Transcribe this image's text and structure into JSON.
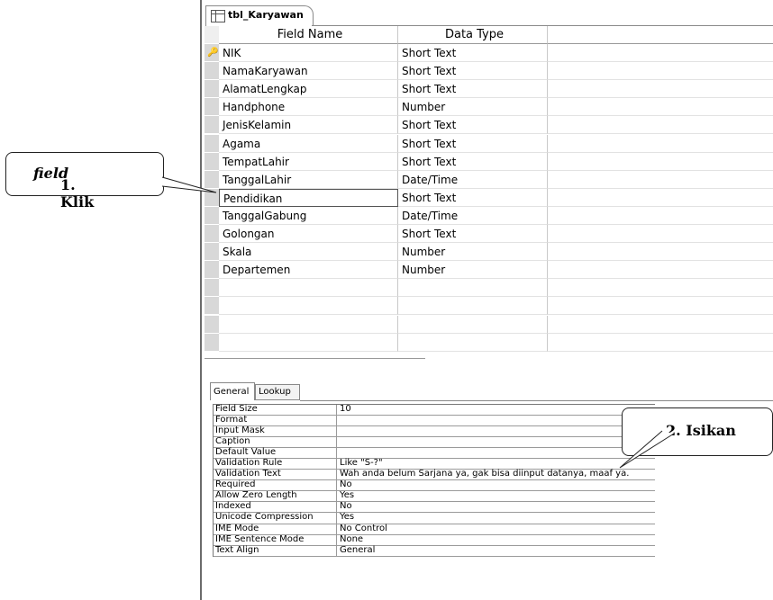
{
  "window": {
    "tab_title": "tbl_Karyawan",
    "tab_icon": "table-icon"
  },
  "grid": {
    "headers": {
      "field_name": "Field Name",
      "data_type": "Data Type"
    },
    "rows": [
      {
        "field": "NIK",
        "type": "Short Text",
        "key": true
      },
      {
        "field": "NamaKaryawan",
        "type": "Short Text"
      },
      {
        "field": "AlamatLengkap",
        "type": "Short Text"
      },
      {
        "field": "Handphone",
        "type": "Number"
      },
      {
        "field": "JenisKelamin",
        "type": "Short Text"
      },
      {
        "field": "Agama",
        "type": "Short Text"
      },
      {
        "field": "TempatLahir",
        "type": "Short Text"
      },
      {
        "field": "TanggalLahir",
        "type": "Date/Time"
      },
      {
        "field": "Pendidikan",
        "type": "Short Text",
        "active": true
      },
      {
        "field": "TanggalGabung",
        "type": "Date/Time"
      },
      {
        "field": "Golongan",
        "type": "Short Text"
      },
      {
        "field": "Skala",
        "type": "Number"
      },
      {
        "field": "Departemen",
        "type": "Number"
      },
      {
        "field": "",
        "type": ""
      },
      {
        "field": "",
        "type": ""
      },
      {
        "field": "",
        "type": ""
      },
      {
        "field": "",
        "type": ""
      }
    ]
  },
  "properties": {
    "tabs": {
      "general": "General",
      "lookup": "Lookup"
    },
    "rows": [
      {
        "label": "Field Size",
        "value": "10"
      },
      {
        "label": "Format",
        "value": ""
      },
      {
        "label": "Input Mask",
        "value": ""
      },
      {
        "label": "Caption",
        "value": ""
      },
      {
        "label": "Default Value",
        "value": ""
      },
      {
        "label": "Validation Rule",
        "value": "Like \"S-?\""
      },
      {
        "label": "Validation Text",
        "value": "Wah anda belum Sarjana ya, gak bisa diinput datanya, maaf ya."
      },
      {
        "label": "Required",
        "value": "No"
      },
      {
        "label": "Allow Zero Length",
        "value": "Yes"
      },
      {
        "label": "Indexed",
        "value": "No"
      },
      {
        "label": "Unicode Compression",
        "value": "Yes"
      },
      {
        "label": "IME Mode",
        "value": "No Control"
      },
      {
        "label": "IME Sentence Mode",
        "value": "None"
      },
      {
        "label": "Text Align",
        "value": "General"
      }
    ]
  },
  "callouts": {
    "step1_text": "1. Klik ",
    "step1_emph": "field",
    "step2_text": "2. Isikan"
  }
}
